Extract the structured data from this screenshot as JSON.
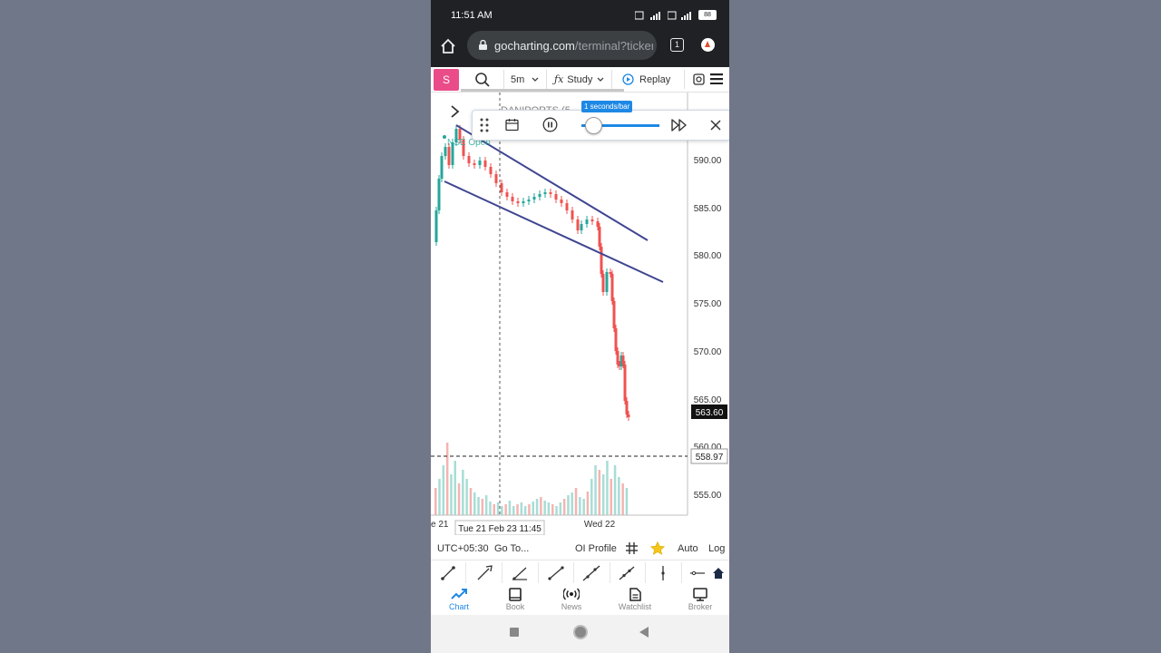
{
  "status_bar": {
    "time": "11:51 AM",
    "battery": "88"
  },
  "browser": {
    "url_host": "gocharting.com",
    "url_path": "/terminal?ticker",
    "tab_count": "1"
  },
  "toolbar": {
    "symbol_button": "S",
    "interval": "5m",
    "study_label": "Study",
    "replay_label": "Replay"
  },
  "replay_bar": {
    "speed_label": "1 seconds/bar",
    "speed_fraction": 0.14
  },
  "chart": {
    "symbol_partial": "DANIPORTS (5",
    "market_status": "NSE Open",
    "price_labels": [
      "590.00",
      "585.00",
      "580.00",
      "575.00",
      "570.00",
      "565.00",
      "560.00",
      "555.00"
    ],
    "last_price": "563.60",
    "crosshair_price": "558.97",
    "time_labels": {
      "left": "e 21",
      "crosshair": "Tue 21 Feb 23 11:45",
      "right": "Wed 22"
    }
  },
  "bottom_toolbar": {
    "timezone": "UTC+05:30",
    "goto": "Go To...",
    "oi_profile": "OI Profile",
    "auto": "Auto",
    "log": "Log"
  },
  "nav": {
    "items": [
      {
        "label": "Chart",
        "icon": "trend-chart-icon"
      },
      {
        "label": "Book",
        "icon": "book-icon"
      },
      {
        "label": "News",
        "icon": "broadcast-icon"
      },
      {
        "label": "Watchlist",
        "icon": "document-icon"
      },
      {
        "label": "Broker",
        "icon": "monitor-icon"
      }
    ]
  },
  "colors": {
    "accent": "#1e88e5",
    "pink": "#ea4c89",
    "up": "#26a69a",
    "down": "#ef5350",
    "trendline": "#3f4591"
  }
}
